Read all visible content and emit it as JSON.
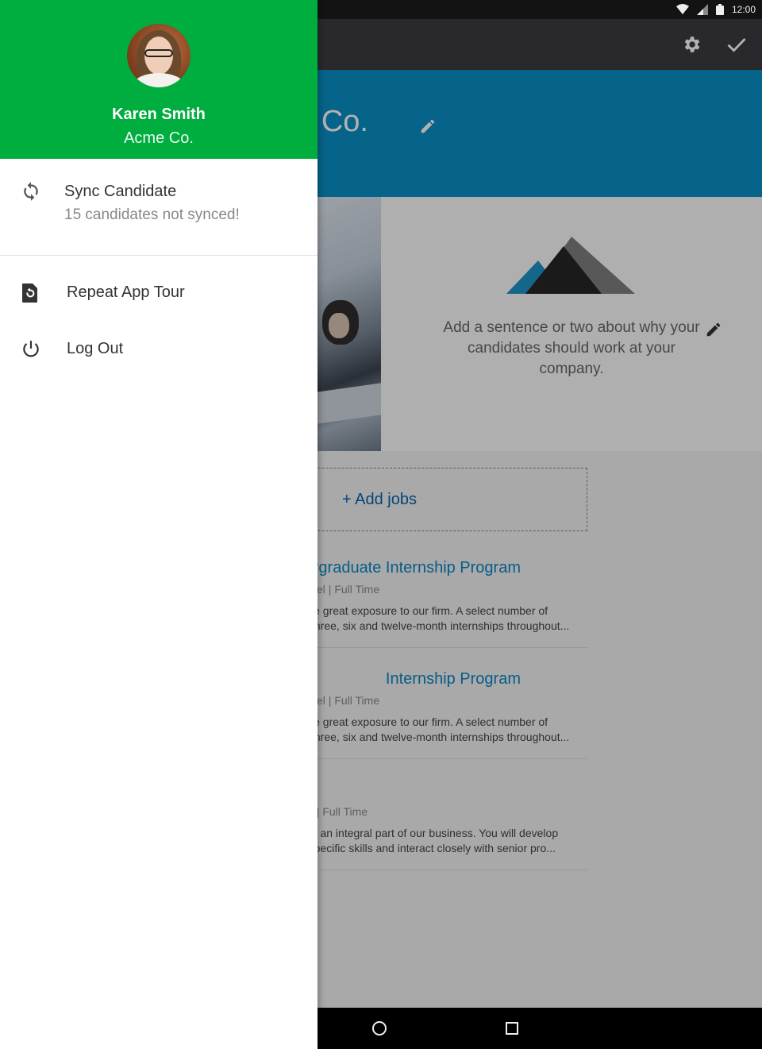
{
  "status_bar": {
    "time": "12:00"
  },
  "hero": {
    "company_title": "ne Co."
  },
  "about": {
    "text": "Add a sentence or two about why your candidates should work at your company."
  },
  "add_jobs": {
    "label": "+ Add jobs"
  },
  "jobs": [
    {
      "title": "rgraduate Internship Program",
      "meta": "vel  |  Full Time",
      "desc": "le great exposure to our firm. A select number of\n three, six and twelve-month internships throughout..."
    },
    {
      "title": "Internship Program",
      "meta": "vel  |  Full Time",
      "desc": "le great exposure to our firm. A select number of\n three, six and twelve-month internships throughout..."
    },
    {
      "title": "",
      "meta": "el  |  Full Time",
      "desc": "be an integral part of our business. You will develop\n-specific skills and interact closely with senior pro..."
    }
  ],
  "drawer": {
    "user": {
      "name": "Karen Smith",
      "org": "Acme Co."
    },
    "sync": {
      "title": "Sync Candidate",
      "subtitle": "15 candidates not synced!"
    },
    "items": [
      {
        "label": "Repeat App Tour",
        "icon": "restore-page-icon"
      },
      {
        "label": "Log Out",
        "icon": "power-icon"
      }
    ]
  },
  "colors": {
    "drawer_header": "#00ad3f",
    "hero": "#0a8ec5",
    "app_bar": "#3b3a41",
    "link": "#0b86c4"
  }
}
